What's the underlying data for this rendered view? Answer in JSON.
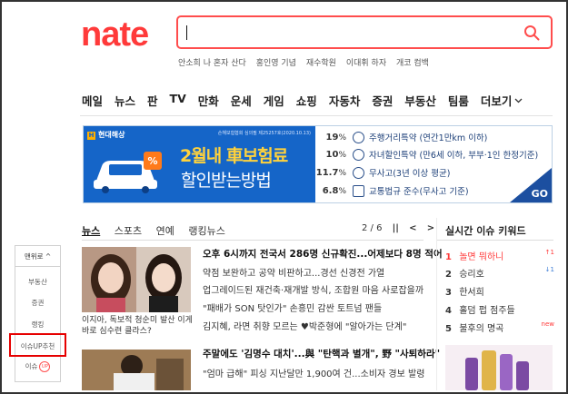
{
  "logo": "nate",
  "search": {
    "value": "",
    "placeholder": ""
  },
  "search_suggestions": [
    "안소희 나 혼자 산다",
    "홍인영 기념",
    "재수학원",
    "이대휘 하자",
    "개코 컴백"
  ],
  "nav": [
    "메일",
    "뉴스",
    "판",
    "TV",
    "만화",
    "운세",
    "게임",
    "쇼핑",
    "자동차",
    "증권",
    "부동산",
    "팀룸",
    "더보기"
  ],
  "banner": {
    "brand": "현대해상",
    "approval": "손해보험협회 심의필 제25257호(2020.10.13)",
    "title": "2월내 車보험료",
    "subtitle": "할인받는방법",
    "rates": [
      {
        "pct": "19",
        "unit": "%",
        "label": "주행거리특약 (연간1만km 이하)"
      },
      {
        "pct": "10",
        "unit": "%",
        "label": "자녀할인특약 (만6세 이하, 부부·1인 한정기준)"
      },
      {
        "pct": "11.7",
        "unit": "%",
        "label": "무사고(3년 이상 평균)"
      },
      {
        "pct": "6.8",
        "unit": "%",
        "label": "교통법규 준수(무사고 기준)"
      }
    ],
    "go": "GO"
  },
  "rail": {
    "header": "맨위로 ^",
    "items": [
      "부동산",
      "증권",
      "랭킹",
      "이슈UP추천",
      "이슈"
    ],
    "badge": "UP"
  },
  "news": {
    "tabs": [
      "뉴스",
      "스포츠",
      "연예",
      "랭킹뉴스"
    ],
    "pager": "2 / 6",
    "pause": "||",
    "prev": "<",
    "next": ">",
    "photo_caption": "이지아, 독보적 청순미 발산 이게 바로 심수련 클라스?",
    "headlines": [
      "오후 6시까지 전국서 286명 신규확진...어제보다 8명 적어",
      "약점 보완하고 공약 비판하고...경선 신경전 가열",
      "업그레이드된 재건축·재개발 방식, 조합원 마음 사로잡을까",
      "\"패배가 SON 탓인가\" 손흥민 감싼 토트넘 팬들",
      "김지혜, 라면 취향 모르는 ♥박준형에 \"알아가는 단계\"",
      "주말에도 '김명수 대치'...與 \"탄핵과 별개\", 野 \"사퇴하라\"",
      "\"엄마 급해\" 피싱 지난달만 1,900여 건...소비자 경보 발령"
    ]
  },
  "realtime": {
    "title": "실시간 이슈 키워드",
    "keywords": [
      {
        "rank": "1",
        "term": "놀면 뭐하니",
        "change": "↑1",
        "dir": "up"
      },
      {
        "rank": "2",
        "term": "승리호",
        "change": "↓1",
        "dir": "down"
      },
      {
        "rank": "3",
        "term": "한서희",
        "change": "",
        "dir": ""
      },
      {
        "rank": "4",
        "term": "홀덤 펍 점주들",
        "change": "",
        "dir": ""
      },
      {
        "rank": "5",
        "term": "불후의 명곡",
        "change": "new",
        "dir": "new"
      }
    ]
  }
}
